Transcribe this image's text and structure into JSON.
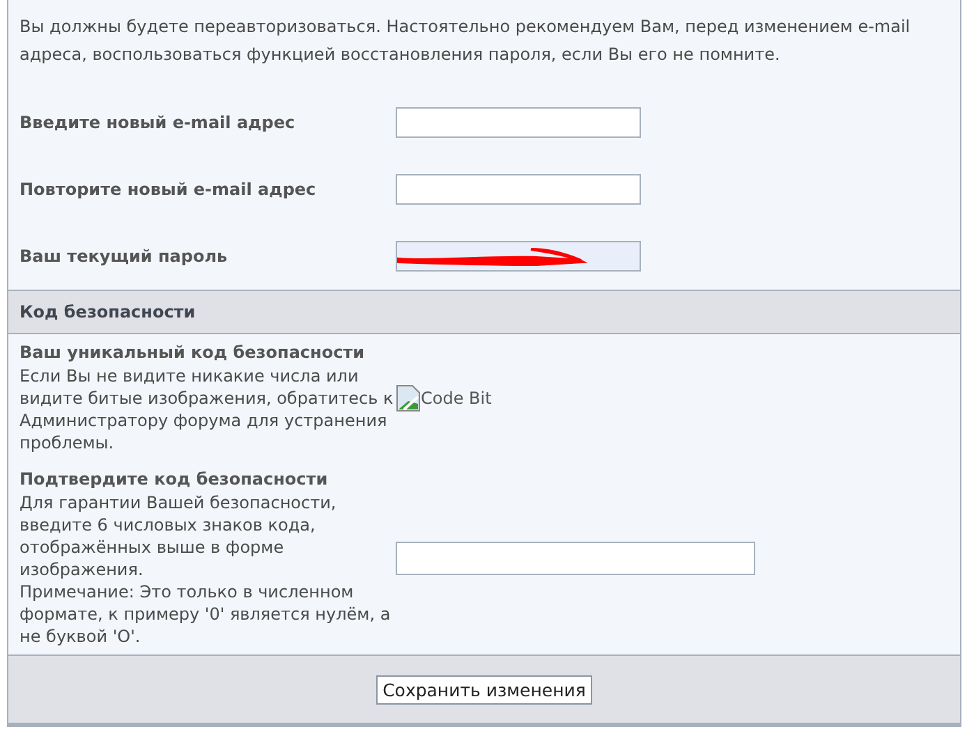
{
  "notice": "Вы должны будете переавторизоваться. Настоятельно рекомендуем Вам, перед изменением e-mail адреса, воспользоваться функцией восстановления пароля, если Вы его не помните.",
  "fields": [
    {
      "label": "Введите новый e-mail адрес",
      "kind": "text"
    },
    {
      "label": "Повторите новый e-mail адрес",
      "kind": "text"
    },
    {
      "label": "Ваш текущий пароль",
      "kind": "redacted"
    }
  ],
  "section": {
    "title": "Код безопасности"
  },
  "security": [
    {
      "title": "Ваш уникальный код безопасности",
      "description": "Если Вы не видите никакие числа или видите битые изображения, обратитесь к Администратору форума для устранения проблемы.",
      "kind": "image",
      "alt": "Code Bit"
    },
    {
      "title": "Подтвердите код безопасности",
      "description": "Для гарантии Вашей безопасности, введите 6 числовых знаков кода, отображённых выше в форме изображения.\nПримечание: Это только в численном формате, к примеру '0' является нулём, а не буквой 'O'.",
      "kind": "input"
    }
  ],
  "buttons": [
    "Сохранить изменения"
  ]
}
